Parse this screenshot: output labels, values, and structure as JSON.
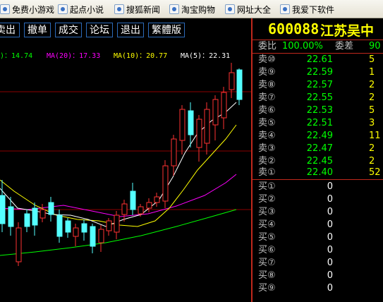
{
  "links_bar": {
    "items": [
      {
        "label": "免费小游戏",
        "icon": "page-icon"
      },
      {
        "label": "起点小说",
        "icon": "page-icon"
      },
      {
        "label": "搜狐新闻",
        "icon": "page-icon"
      },
      {
        "label": "淘宝购物",
        "icon": "page-icon"
      },
      {
        "label": "网址大全",
        "icon": "page-icon"
      },
      {
        "label": "我爱下软件",
        "icon": "page-icon"
      }
    ]
  },
  "toolbar": {
    "buttons": [
      "卖出",
      "撤单",
      "成交",
      "论坛",
      "退出",
      "繁體版"
    ]
  },
  "ma_legend": {
    "ma_prev": ")：14.74",
    "ma20": "MA(20)：17.33",
    "ma10": "MA(10)：20.77",
    "ma5": "MA(5)：22.31"
  },
  "quote": {
    "code": "600088",
    "name": "江苏吴中",
    "ratio_label": "委比",
    "ratio_value": "100.00%",
    "diff_label": "委差",
    "diff_value": "90",
    "sell_rows": [
      {
        "label": "卖⑩",
        "price": "22.61",
        "vol": "5"
      },
      {
        "label": "卖⑨",
        "price": "22.59",
        "vol": "1"
      },
      {
        "label": "卖⑧",
        "price": "22.57",
        "vol": "2"
      },
      {
        "label": "卖⑦",
        "price": "22.55",
        "vol": "2"
      },
      {
        "label": "卖⑥",
        "price": "22.53",
        "vol": "5"
      },
      {
        "label": "卖⑤",
        "price": "22.51",
        "vol": "3"
      },
      {
        "label": "卖④",
        "price": "22.49",
        "vol": "11"
      },
      {
        "label": "卖③",
        "price": "22.47",
        "vol": "2"
      },
      {
        "label": "卖②",
        "price": "22.45",
        "vol": "2"
      },
      {
        "label": "卖①",
        "price": "22.40",
        "vol": "52"
      }
    ],
    "buy_rows": [
      {
        "label": "买①",
        "price": "0"
      },
      {
        "label": "买②",
        "price": "0"
      },
      {
        "label": "买③",
        "price": "0"
      },
      {
        "label": "买④",
        "price": "0"
      },
      {
        "label": "买⑤",
        "price": "0"
      },
      {
        "label": "买⑥",
        "price": "0"
      },
      {
        "label": "买⑦",
        "price": "0"
      },
      {
        "label": "买⑧",
        "price": "0"
      },
      {
        "label": "买⑨",
        "price": "0"
      }
    ]
  },
  "colors": {
    "up": "#ff3232",
    "down": "#54ffff",
    "ma5": "#ffffff",
    "ma10": "#ffff00",
    "ma20": "#ff00ff",
    "ma_long": "#00ff00",
    "grid": "#8b0000"
  }
}
